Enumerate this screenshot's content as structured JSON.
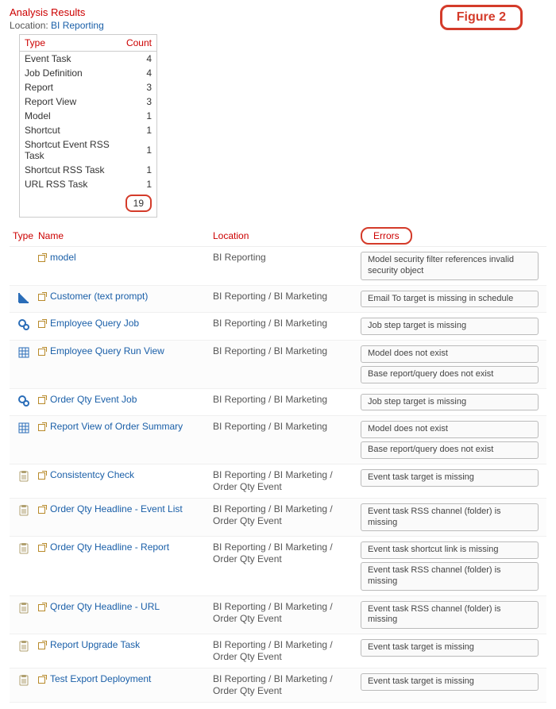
{
  "figure_label": "Figure 2",
  "page_title": "Analysis Results",
  "location_label": "Location:",
  "location_value": "BI Reporting",
  "summary": {
    "headers": {
      "type": "Type",
      "count": "Count"
    },
    "rows": [
      {
        "type": "Event Task",
        "count": 4
      },
      {
        "type": "Job Definition",
        "count": 4
      },
      {
        "type": "Report",
        "count": 3
      },
      {
        "type": "Report View",
        "count": 3
      },
      {
        "type": "Model",
        "count": 1
      },
      {
        "type": "Shortcut",
        "count": 1
      },
      {
        "type": "Shortcut Event RSS Task",
        "count": 1
      },
      {
        "type": "Shortcut RSS Task",
        "count": 1
      },
      {
        "type": "URL RSS Task",
        "count": 1
      }
    ],
    "total": 19
  },
  "columns": {
    "type": "Type",
    "name": "Name",
    "location": "Location",
    "errors": "Errors"
  },
  "items": [
    {
      "icon": "none",
      "name": "model",
      "location": "BI Reporting",
      "errors": [
        "Model security filter references invalid security object"
      ]
    },
    {
      "icon": "triangle",
      "name": "Customer (text prompt)",
      "location": "BI Reporting / BI Marketing",
      "errors": [
        "Email To target is missing in schedule"
      ]
    },
    {
      "icon": "gears",
      "name": "Employee Query Job",
      "location": "BI Reporting / BI Marketing",
      "errors": [
        "Job step target is missing"
      ]
    },
    {
      "icon": "grid",
      "name": "Employee Query Run View",
      "location": "BI Reporting / BI Marketing",
      "errors": [
        "Model does not exist",
        "Base report/query does not exist"
      ]
    },
    {
      "icon": "gears",
      "name": "Order Qty Event Job",
      "location": "BI Reporting / BI Marketing",
      "errors": [
        "Job step target is missing"
      ]
    },
    {
      "icon": "grid",
      "name": "Report View of Order Summary",
      "location": "BI Reporting / BI Marketing",
      "errors": [
        "Model does not exist",
        "Base report/query does not exist"
      ]
    },
    {
      "icon": "clipboard",
      "name": "Consistentcy Check",
      "location": "BI Reporting / BI Marketing / Order Qty Event",
      "errors": [
        "Event task target is missing"
      ]
    },
    {
      "icon": "clipboard",
      "name": "Order Qty Headline - Event List",
      "location": "BI Reporting / BI Marketing / Order Qty Event",
      "errors": [
        "Event task RSS channel (folder) is missing"
      ]
    },
    {
      "icon": "clipboard",
      "name": "Order Qty Headline - Report",
      "location": "BI Reporting / BI Marketing / Order Qty Event",
      "errors": [
        "Event task shortcut link is missing",
        "Event task RSS channel (folder) is missing"
      ]
    },
    {
      "icon": "clipboard",
      "name": "Qrder Qty Headline - URL",
      "location": "BI Reporting / BI Marketing / Order Qty Event",
      "errors": [
        "Event task RSS channel (folder) is missing"
      ]
    },
    {
      "icon": "clipboard",
      "name": "Report Upgrade Task",
      "location": "BI Reporting / BI Marketing / Order Qty Event",
      "errors": [
        "Event task target is missing"
      ]
    },
    {
      "icon": "clipboard",
      "name": "Test Export Deployment",
      "location": "BI Reporting / BI Marketing / Order Qty Event",
      "errors": [
        "Event task target is missing"
      ]
    }
  ]
}
